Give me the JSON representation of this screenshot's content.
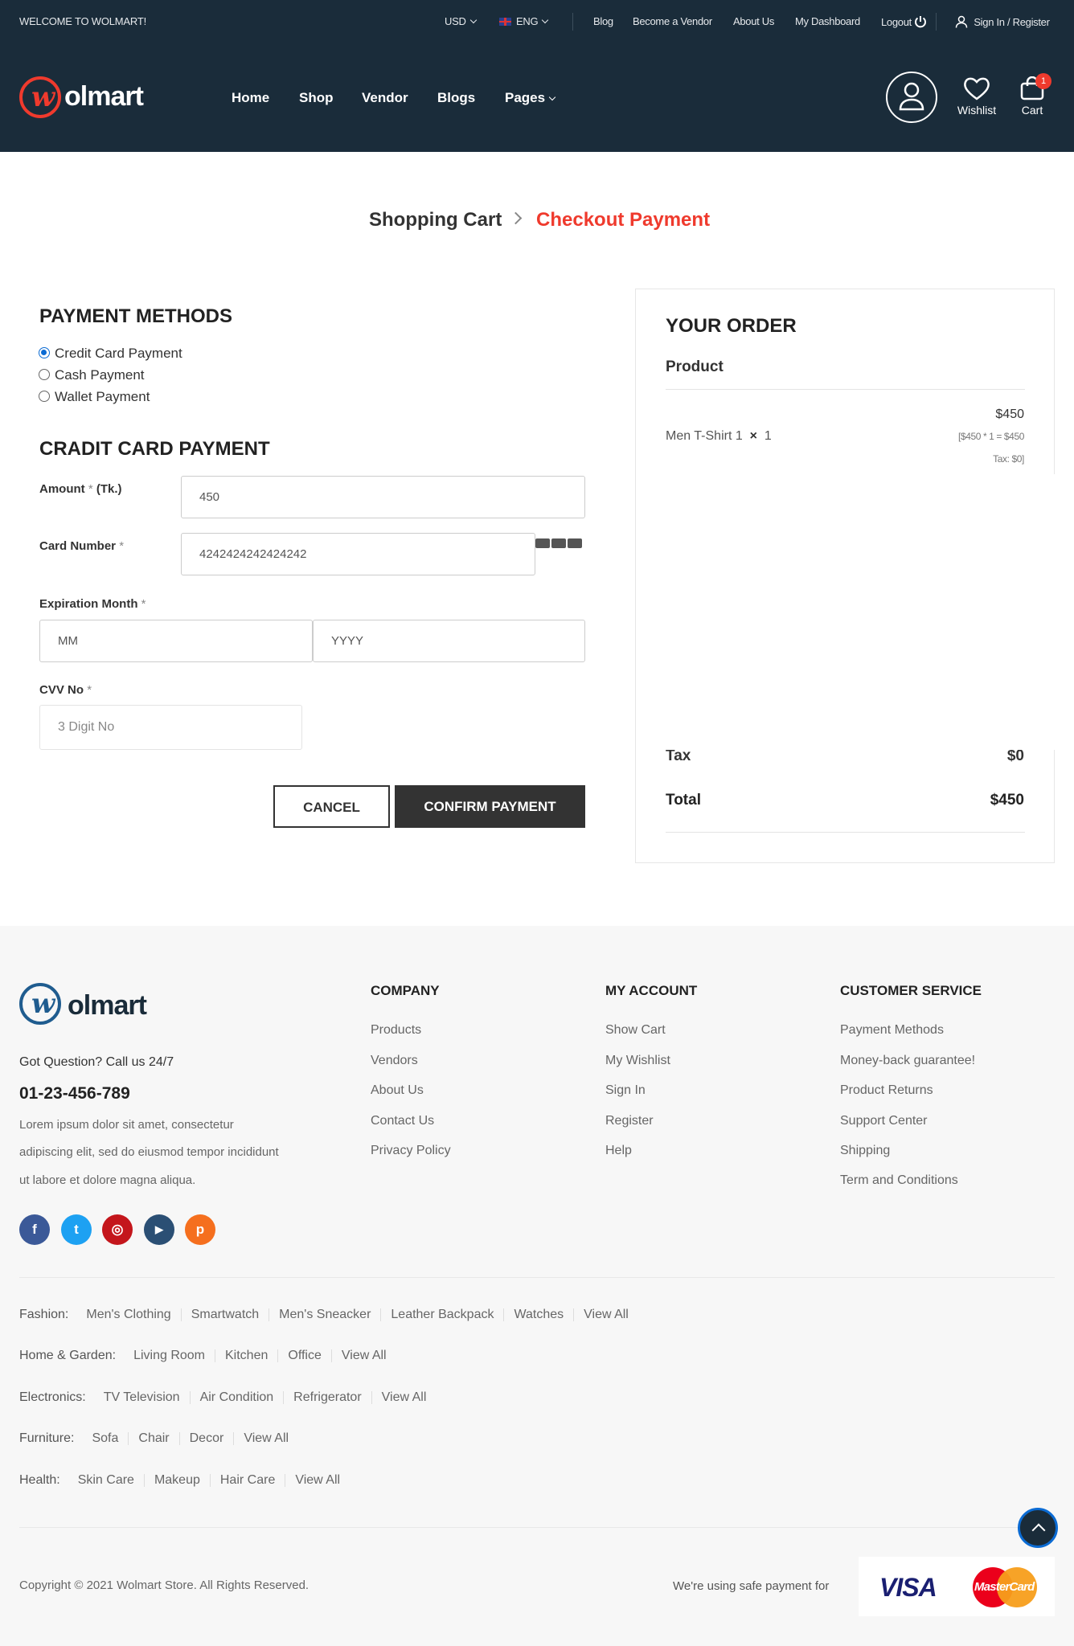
{
  "topbar": {
    "welcome": "WELCOME TO WOLMART!",
    "currency": "USD",
    "language": "ENG",
    "links": [
      "Blog",
      "Become a Vendor",
      "About Us",
      "My Dashboard",
      "Logout"
    ],
    "signin": "Sign In / Register"
  },
  "header": {
    "logo_mark": "w",
    "logo_text": "olmart",
    "nav": [
      "Home",
      "Shop",
      "Vendor",
      "Blogs",
      "Pages"
    ],
    "wishlist_label": "Wishlist",
    "cart_label": "Cart",
    "cart_count": "1",
    "icons": [
      "user-icon",
      "heart-icon",
      "bag-icon",
      "power-icon",
      "person-icon"
    ]
  },
  "breadcrumb": {
    "step1": "Shopping Cart",
    "step2": "Checkout Payment"
  },
  "payment": {
    "title": "PAYMENT METHODS",
    "methods": [
      "Credit Card Payment",
      "Cash Payment",
      "Wallet Payment"
    ],
    "selected": "Credit Card Payment",
    "card_title": "CRADIT CARD PAYMENT",
    "amount_label": "Amount",
    "amount_unit": "(Tk.)",
    "amount_value": "450",
    "card_label": "Card Number",
    "card_value": "4242424242424242",
    "exp_label": "Expiration Month",
    "month_placeholder": "MM",
    "year_placeholder": "YYYY",
    "cvv_label": "CVV No",
    "cvv_placeholder": "3 Digit No",
    "required_mark": "*",
    "cancel": "CANCEL",
    "confirm": "CONFIRM PAYMENT"
  },
  "order": {
    "title": "YOUR ORDER",
    "product_header": "Product",
    "item_name": "Men T-Shirt 1",
    "item_x": "×",
    "item_qty": "1",
    "item_price": "$450",
    "item_calc": "[$450 * 1 = $450",
    "item_tax": "Tax: $0]",
    "tax_label": "Tax",
    "tax_value": "$0",
    "total_label": "Total",
    "total_value": "$450"
  },
  "footer": {
    "logo_mark": "w",
    "logo_text": "olmart",
    "question": "Got Question? Call us 24/7",
    "phone": "01-23-456-789",
    "about": [
      "Lorem ipsum dolor sit amet, consectetur",
      "adipiscing elit, sed do eiusmod tempor incididunt",
      "ut labore et dolore magna aliqua."
    ],
    "social": [
      {
        "icon": "facebook-icon",
        "glyph": "f",
        "color": "#3b5998"
      },
      {
        "icon": "twitter-icon",
        "glyph": "t",
        "color": "#1da1f2"
      },
      {
        "icon": "instagram-icon",
        "glyph": "◎",
        "color": "#c4161c"
      },
      {
        "icon": "youtube-icon",
        "glyph": "▶",
        "color": "#2b4f74"
      },
      {
        "icon": "pinterest-icon",
        "glyph": "p",
        "color": "#f56f1e"
      }
    ],
    "columns": [
      {
        "title": "COMPANY",
        "links": [
          "Products",
          "Vendors",
          "About Us",
          "Contact Us",
          "Privacy Policy"
        ]
      },
      {
        "title": "MY ACCOUNT",
        "links": [
          "Show Cart",
          "My Wishlist",
          "Sign In",
          "Register",
          "Help"
        ]
      },
      {
        "title": "CUSTOMER SERVICE",
        "links": [
          "Payment Methods",
          "Money-back guarantee!",
          "Product Returns",
          "Support Center",
          "Shipping",
          "Term and Conditions"
        ]
      }
    ],
    "categories": [
      {
        "label": "Fashion:",
        "items": [
          "Men's Clothing",
          "Smartwatch",
          "Men's Sneacker",
          "Leather Backpack",
          "Watches",
          "View All"
        ]
      },
      {
        "label": "Home & Garden:",
        "items": [
          "Living Room",
          "Kitchen",
          "Office",
          "View All"
        ]
      },
      {
        "label": "Electronics:",
        "items": [
          "TV Television",
          "Air Condition",
          "Refrigerator",
          "View All"
        ]
      },
      {
        "label": "Furniture:",
        "items": [
          "Sofa",
          "Chair",
          "Decor",
          "View All"
        ]
      },
      {
        "label": "Health:",
        "items": [
          "Skin Care",
          "Makeup",
          "Hair Care",
          "View All"
        ]
      }
    ],
    "copyright": "Copyright © 2021 Wolmart Store. All Rights Reserved.",
    "safe_payment": "We're using safe payment for",
    "visa": "VISA",
    "mastercard": "MasterCard"
  },
  "colors": {
    "accent": "#ef3a2d",
    "header_bg": "#1a2c3a",
    "dark_button": "#333333"
  }
}
